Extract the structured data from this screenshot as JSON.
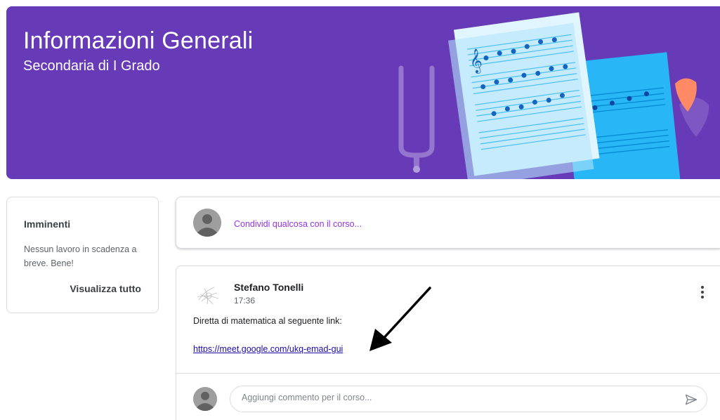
{
  "banner": {
    "title": "Informazioni Generali",
    "subtitle": "Secondaria di I Grado",
    "color": "#673ab7"
  },
  "upcoming": {
    "title": "Imminenti",
    "message": "Nessun lavoro in scadenza a breve. Bene!",
    "view_all": "Visualizza tutto"
  },
  "share": {
    "prompt": "Condividi qualcosa con il corso...",
    "accent": "#9334e6"
  },
  "post": {
    "author": "Stefano Tonelli",
    "time": "17:36",
    "body": "Diretta di matematica al seguente link:",
    "link": "https://meet.google.com/ukq-emad-gui"
  },
  "comment": {
    "placeholder": "Aggiungi commento per il corso..."
  },
  "icons": [
    "tuning-fork-icon",
    "sheet-music-icon",
    "guitar-pick-icon",
    "avatar-icon",
    "more-vert-icon",
    "send-icon",
    "arrow-annotation-icon"
  ]
}
